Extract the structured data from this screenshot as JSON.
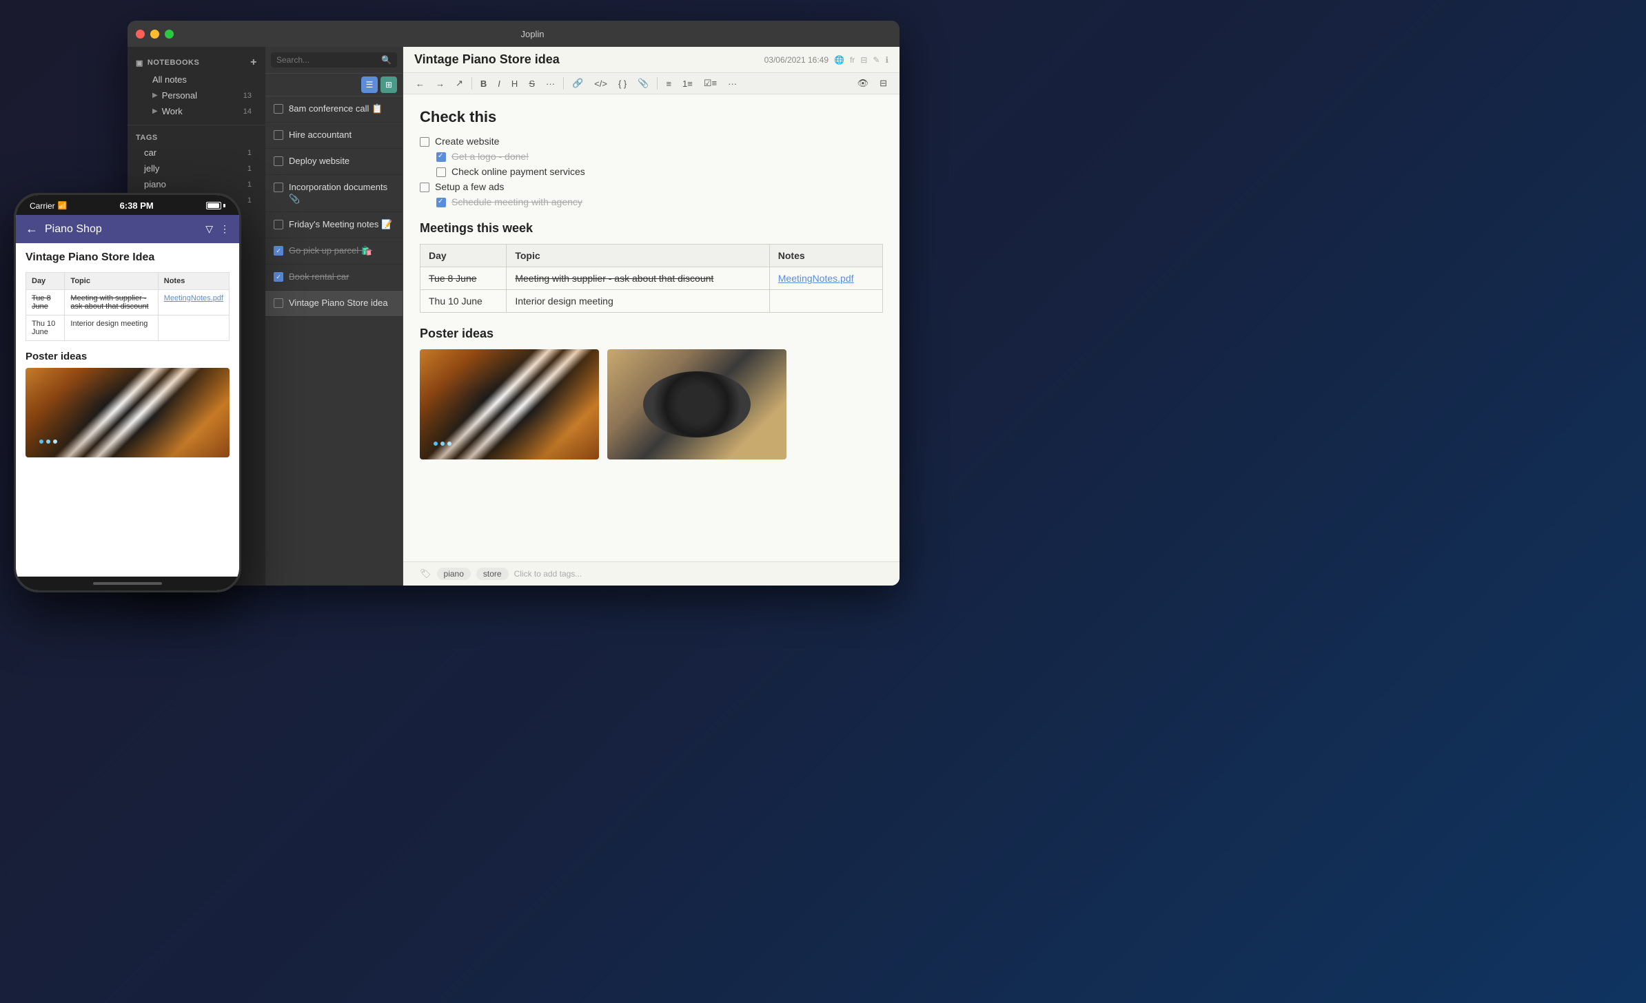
{
  "app": {
    "title": "Joplin",
    "window_title": "Joplin"
  },
  "sidebar": {
    "notebooks_label": "NOTEBOOKS",
    "add_button": "+",
    "all_notes_label": "All notes",
    "personal_label": "Personal",
    "personal_count": "13",
    "work_label": "Work",
    "work_count": "14",
    "tags_label": "TAGS",
    "tag_car": "car",
    "tag_car_count": "1",
    "tag_jelly": "jelly",
    "tag_jelly_count": "1",
    "tag_piano": "piano",
    "tag_piano_count": "1",
    "tag_store": "store",
    "tag_store_count": "1"
  },
  "note_list": {
    "search_placeholder": "Search...",
    "notes": [
      {
        "id": 1,
        "title": "8am conference call 📋",
        "checked": false,
        "strikethrough": false
      },
      {
        "id": 2,
        "title": "Hire accountant",
        "checked": false,
        "strikethrough": false
      },
      {
        "id": 3,
        "title": "Deploy website",
        "checked": false,
        "strikethrough": false
      },
      {
        "id": 4,
        "title": "Incorporation documents 📎",
        "checked": false,
        "strikethrough": false
      },
      {
        "id": 5,
        "title": "Friday's Meeting notes 📝",
        "checked": false,
        "strikethrough": false
      },
      {
        "id": 6,
        "title": "Go pick up parcel 🛍️",
        "checked": true,
        "strikethrough": true
      },
      {
        "id": 7,
        "title": "Book rental car",
        "checked": true,
        "strikethrough": true
      },
      {
        "id": 8,
        "title": "Vintage Piano Store idea",
        "checked": false,
        "strikethrough": false,
        "active": true
      }
    ]
  },
  "editor": {
    "note_title": "Vintage Piano Store idea",
    "date": "03/06/2021 16:49",
    "lang": "fr",
    "heading": "Check this",
    "check_items": [
      {
        "id": "ci1",
        "text": "Create website",
        "checked": false,
        "indent": false,
        "muted": false
      },
      {
        "id": "ci2",
        "text": "Get a logo - done!",
        "checked": true,
        "indent": true,
        "muted": true
      },
      {
        "id": "ci3",
        "text": "Check online payment services",
        "checked": false,
        "indent": true,
        "muted": false
      },
      {
        "id": "ci4",
        "text": "Setup a few ads",
        "checked": false,
        "indent": false,
        "muted": false
      },
      {
        "id": "ci5",
        "text": "Schedule meeting with agency",
        "checked": true,
        "indent": true,
        "muted": true
      }
    ],
    "meetings_heading": "Meetings this week",
    "table_headers": [
      "Day",
      "Topic",
      "Notes"
    ],
    "table_rows": [
      {
        "day": "Tue 8 June",
        "day_strike": true,
        "topic": "Meeting with supplier - ask about that discount",
        "topic_strike": true,
        "notes": "MeetingNotes.pdf",
        "notes_link": true
      },
      {
        "day": "Thu 10 June",
        "day_strike": false,
        "topic": "Interior design meeting",
        "topic_strike": false,
        "notes": "",
        "notes_link": false
      }
    ],
    "poster_heading": "Poster ideas",
    "tags": [
      "piano",
      "store"
    ],
    "tag_add_placeholder": "Click to add tags..."
  },
  "mobile": {
    "carrier": "Carrier",
    "time": "6:38 PM",
    "nav_title": "Piano Shop",
    "doc_title": "Vintage Piano Store Idea",
    "table_headers": [
      "Day",
      "Topic",
      "Notes"
    ],
    "table_rows": [
      {
        "day": "Tue 8 June",
        "day_strike": true,
        "topic": "Meeting with supplier - ask about that discount",
        "topic_strike": true,
        "notes": "MeetingNotes.pdf",
        "notes_link": true
      },
      {
        "day": "Thu 10 June",
        "day_strike": false,
        "topic": "Interior design meeting",
        "topic_strike": false,
        "notes": "",
        "notes_link": false
      }
    ],
    "poster_label": "Poster ideas"
  },
  "toolbar": {
    "bold": "B",
    "italic": "I",
    "highlight": "H",
    "strikethrough": "S",
    "more": "...",
    "link": "🔗",
    "code": "</>",
    "more2": "..."
  }
}
